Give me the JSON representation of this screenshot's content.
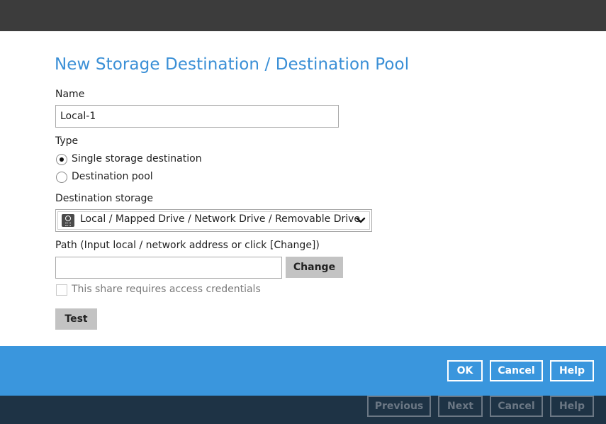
{
  "dialog": {
    "title": "New Storage Destination / Destination Pool",
    "name_label": "Name",
    "name_value": "Local-1",
    "type_label": "Type",
    "type_options": [
      {
        "label": "Single storage destination",
        "selected": true
      },
      {
        "label": "Destination pool",
        "selected": false
      }
    ],
    "destination_storage_label": "Destination storage",
    "destination_storage_value": "Local / Mapped Drive / Network Drive / Removable Drive",
    "destination_storage_icon": "drive-icon",
    "path_label": "Path (Input local / network address or click [Change])",
    "path_value": "",
    "change_button": "Change",
    "credentials_label": "This share requires access credentials",
    "credentials_checked": false,
    "test_button": "Test"
  },
  "action_bar": {
    "ok": "OK",
    "cancel": "Cancel",
    "help": "Help"
  },
  "wizard_bar": {
    "previous": "Previous",
    "next": "Next",
    "cancel": "Cancel",
    "help": "Help"
  },
  "colors": {
    "title_blue": "#3a8fd6",
    "action_bar_blue": "#3a96dd",
    "bottom_bar_navy": "#1e3345",
    "top_bar_gray": "#3c3c3c",
    "button_gray": "#c3c3c3"
  }
}
